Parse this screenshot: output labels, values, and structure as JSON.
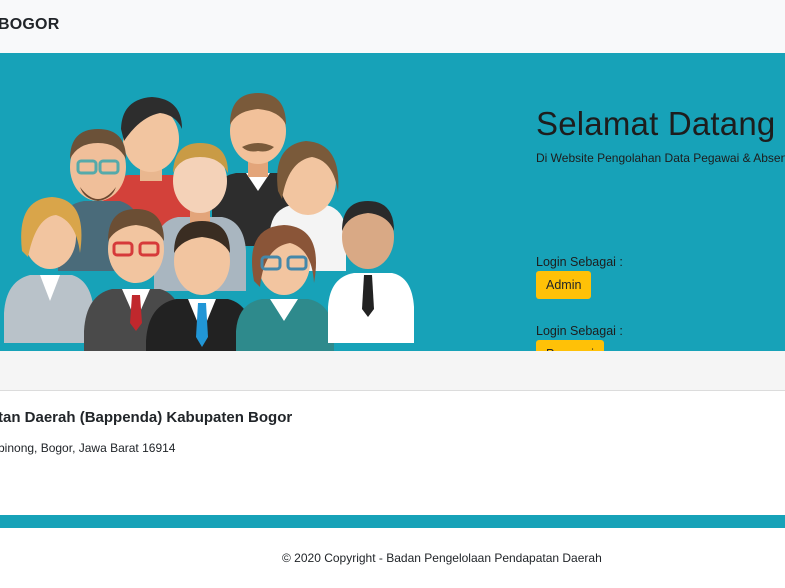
{
  "navbar": {
    "brand": "BOGOR"
  },
  "hero": {
    "title": "Selamat Datang",
    "subtitle": "Di Website Pengolahan Data Pegawai & Absensi",
    "admin_label": "Login Sebagai :",
    "admin_button": "Admin",
    "pegawai_label": "Login Sebagai :",
    "pegawai_button": "Pegawai",
    "illustration": "group-of-employees-illustration"
  },
  "info": {
    "title": "tan Daerah (Bappenda) Kabupaten Bogor",
    "address": "binong, Bogor, Jawa Barat 16914"
  },
  "footer": {
    "copyright": "© 2020 Copyright - Badan Pengelolaan Pendapatan Daerah"
  },
  "colors": {
    "hero_bg": "#17a2b8",
    "button_bg": "#ffc107",
    "navbar_bg": "#f8f9fa"
  }
}
